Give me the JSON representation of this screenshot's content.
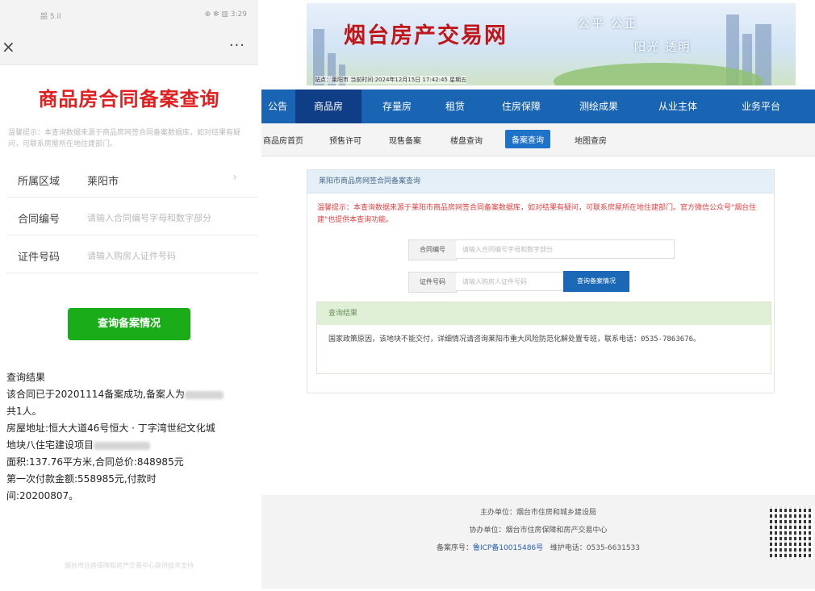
{
  "mobile": {
    "status_left": "㗊 5.il",
    "status_right": "⊕ ✻ ▥ 3:29",
    "close_label": "×",
    "more_label": "···",
    "title": "商品房合同备案查询",
    "tip": "温馨提示：本查询数据来源于商品房网签合同备案数据库，如对结果有疑问，可联系房屋所在地住建部门。",
    "rows": [
      {
        "label": "所属区域",
        "value": "莱阳市",
        "chevron": "›"
      },
      {
        "label": "合同编号",
        "placeholder": "请输入合同编号字母和数字部分"
      },
      {
        "label": "证件号码",
        "placeholder": "请输入购房人证件号码"
      }
    ],
    "query_button": "查询备案情况",
    "result": {
      "heading": "查询结果",
      "line1": "该合同已于20201114备案成功,备案人为",
      "line2": "共1人。",
      "line3": "房屋地址:恒大大道46号恒大 · 丁字湾世纪文化城",
      "line4": "地块八住宅建设项目",
      "line5": "面积:137.76平方米,合同总价:848985元",
      "line6": "第一次付款金额:558985元,付款时",
      "line7": "间:20200807。"
    },
    "footer": "烟台市住房保障和房产交易中心提供技术支持"
  },
  "site": {
    "title": "烟台房产交易网",
    "slogan1": "公平 公正",
    "slogan2": "阳光 透明",
    "location": "站点：莱阳市  当前时间:2024年12月15日 17:42:45 星期五",
    "nav": [
      "公告",
      "商品房",
      "存量房",
      "租赁",
      "住房保障",
      "测绘成果",
      "从业主体",
      "业务平台"
    ],
    "subnav": [
      "商品房首页",
      "预售许可",
      "现售备案",
      "楼盘查询",
      "备案查询",
      "地图查房"
    ],
    "panel_title": "莱阳市商品房网签合同备案查询",
    "panel_tip": "温馨提示：本查询数据来源于莱阳市商品房网签合同备案数据库，如对结果有疑问，可联系房屋所在地住建部门。官方微信公众号\"烟台住建\"也提供本查询功能。",
    "contract_label": "合同编号",
    "contract_placeholder": "请输入合同编号字母和数字部分",
    "id_label": "证件号码",
    "id_placeholder": "请输入购房人证件号码",
    "query_button": "查询备案情况",
    "result_title": "查询结果",
    "result_text": "国家政策原因，该地块不能交付，详细情况请咨询莱阳市重大风险防范化解处置专班，联系电话：0535-7863676。",
    "footer_line1": "主办单位：烟台市住房和城乡建设局",
    "footer_line2": "协办单位：烟台市住房保障和房产交易中心",
    "footer_icp_label": "备案序号：",
    "footer_icp": "鲁ICP备10015486号",
    "footer_phone": "维护电话：0535-6631533"
  }
}
